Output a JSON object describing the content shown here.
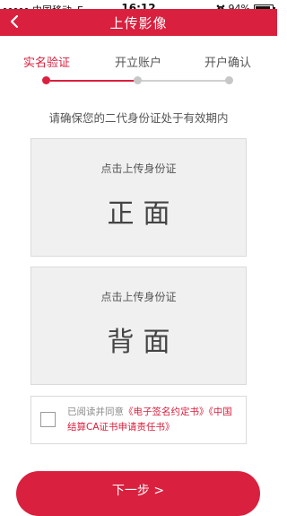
{
  "status_bar": {
    "carrier": "中国移动",
    "network": "E",
    "time": "16:12",
    "battery_text": "94%",
    "battery_level": 0.94
  },
  "nav": {
    "title": "上传影像",
    "back_icon": "chevron-left-icon"
  },
  "steps": [
    {
      "label": "实名验证",
      "active": true
    },
    {
      "label": "开立账户",
      "active": false
    },
    {
      "label": "开户确认",
      "active": false
    }
  ],
  "hint": "请确保您的二代身份证处于有效期内",
  "upload_front": {
    "prompt": "点击上传身份证",
    "side": "正面"
  },
  "upload_back": {
    "prompt": "点击上传身份证",
    "side": "背面"
  },
  "agreement": {
    "prefix": "已阅读并同意",
    "doc1": "《电子签名约定书》",
    "doc2": "《中国结算CA证书申请责任书》",
    "checked": false
  },
  "next_button": "下一步 >",
  "colors": {
    "accent": "#d9203e",
    "inactive": "#c7c7c7",
    "panel": "#f0f0f0"
  }
}
